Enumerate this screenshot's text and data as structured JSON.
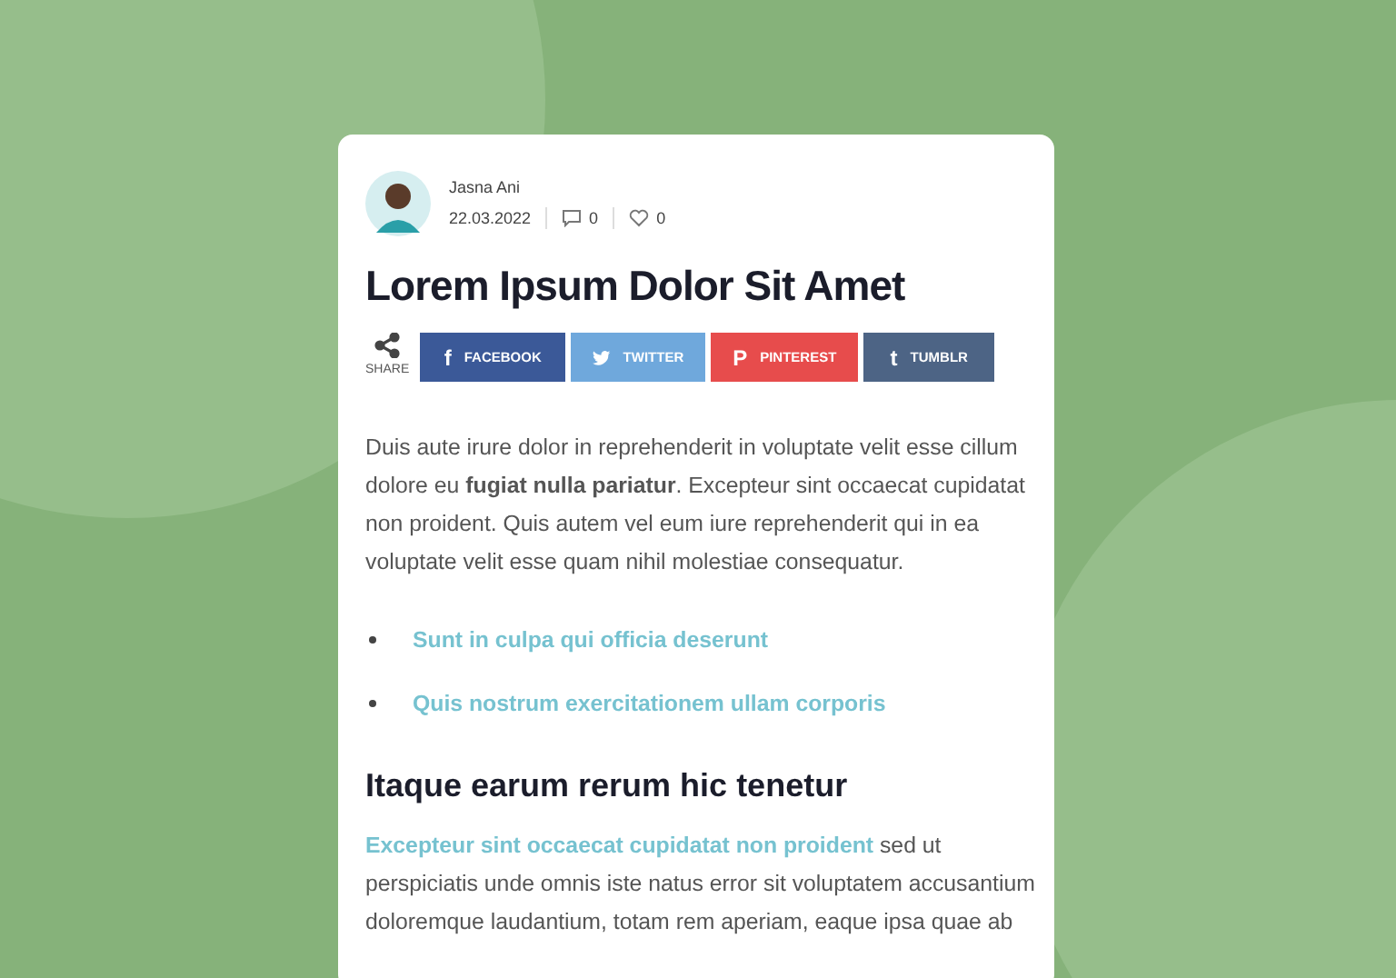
{
  "post": {
    "author": "Jasna Ani",
    "date": "22.03.2022",
    "comments": "0",
    "likes": "0",
    "title": "Lorem Ipsum Dolor Sit Amet"
  },
  "share": {
    "label": "SHARE",
    "buttons": [
      {
        "kind": "facebook",
        "icon": "f",
        "label": "FACEBOOK"
      },
      {
        "kind": "twitter",
        "label": "TWITTER"
      },
      {
        "kind": "pinterest",
        "icon": "P",
        "label": "PINTEREST"
      },
      {
        "kind": "tumblr",
        "icon": "t",
        "label": "TUMBLR"
      }
    ]
  },
  "intro": "Duis aute irure dolor in reprehenderit in voluptate velit esse cillum dolore eu **fugiat nulla pariatur**. Excepteur sint occaecat cupidatat non proident. Quis autem vel eum iure reprehenderit qui in ea voluptate velit esse quam nihil molestiae consequatur.",
  "links": [
    "Sunt in culpa qui officia deserunt",
    "Quis nostrum exercitationem ullam corporis"
  ],
  "heading": "Itaque earum rerum hic tenetur",
  "closing": {
    "link": "Excepteur sint occaecat cupidatat non proident",
    "text": "sed ut perspiciatis unde omnis iste natus error sit voluptatem accusantium doloremque laudantium, totam rem aperiam, eaque ipsa quae ab"
  }
}
